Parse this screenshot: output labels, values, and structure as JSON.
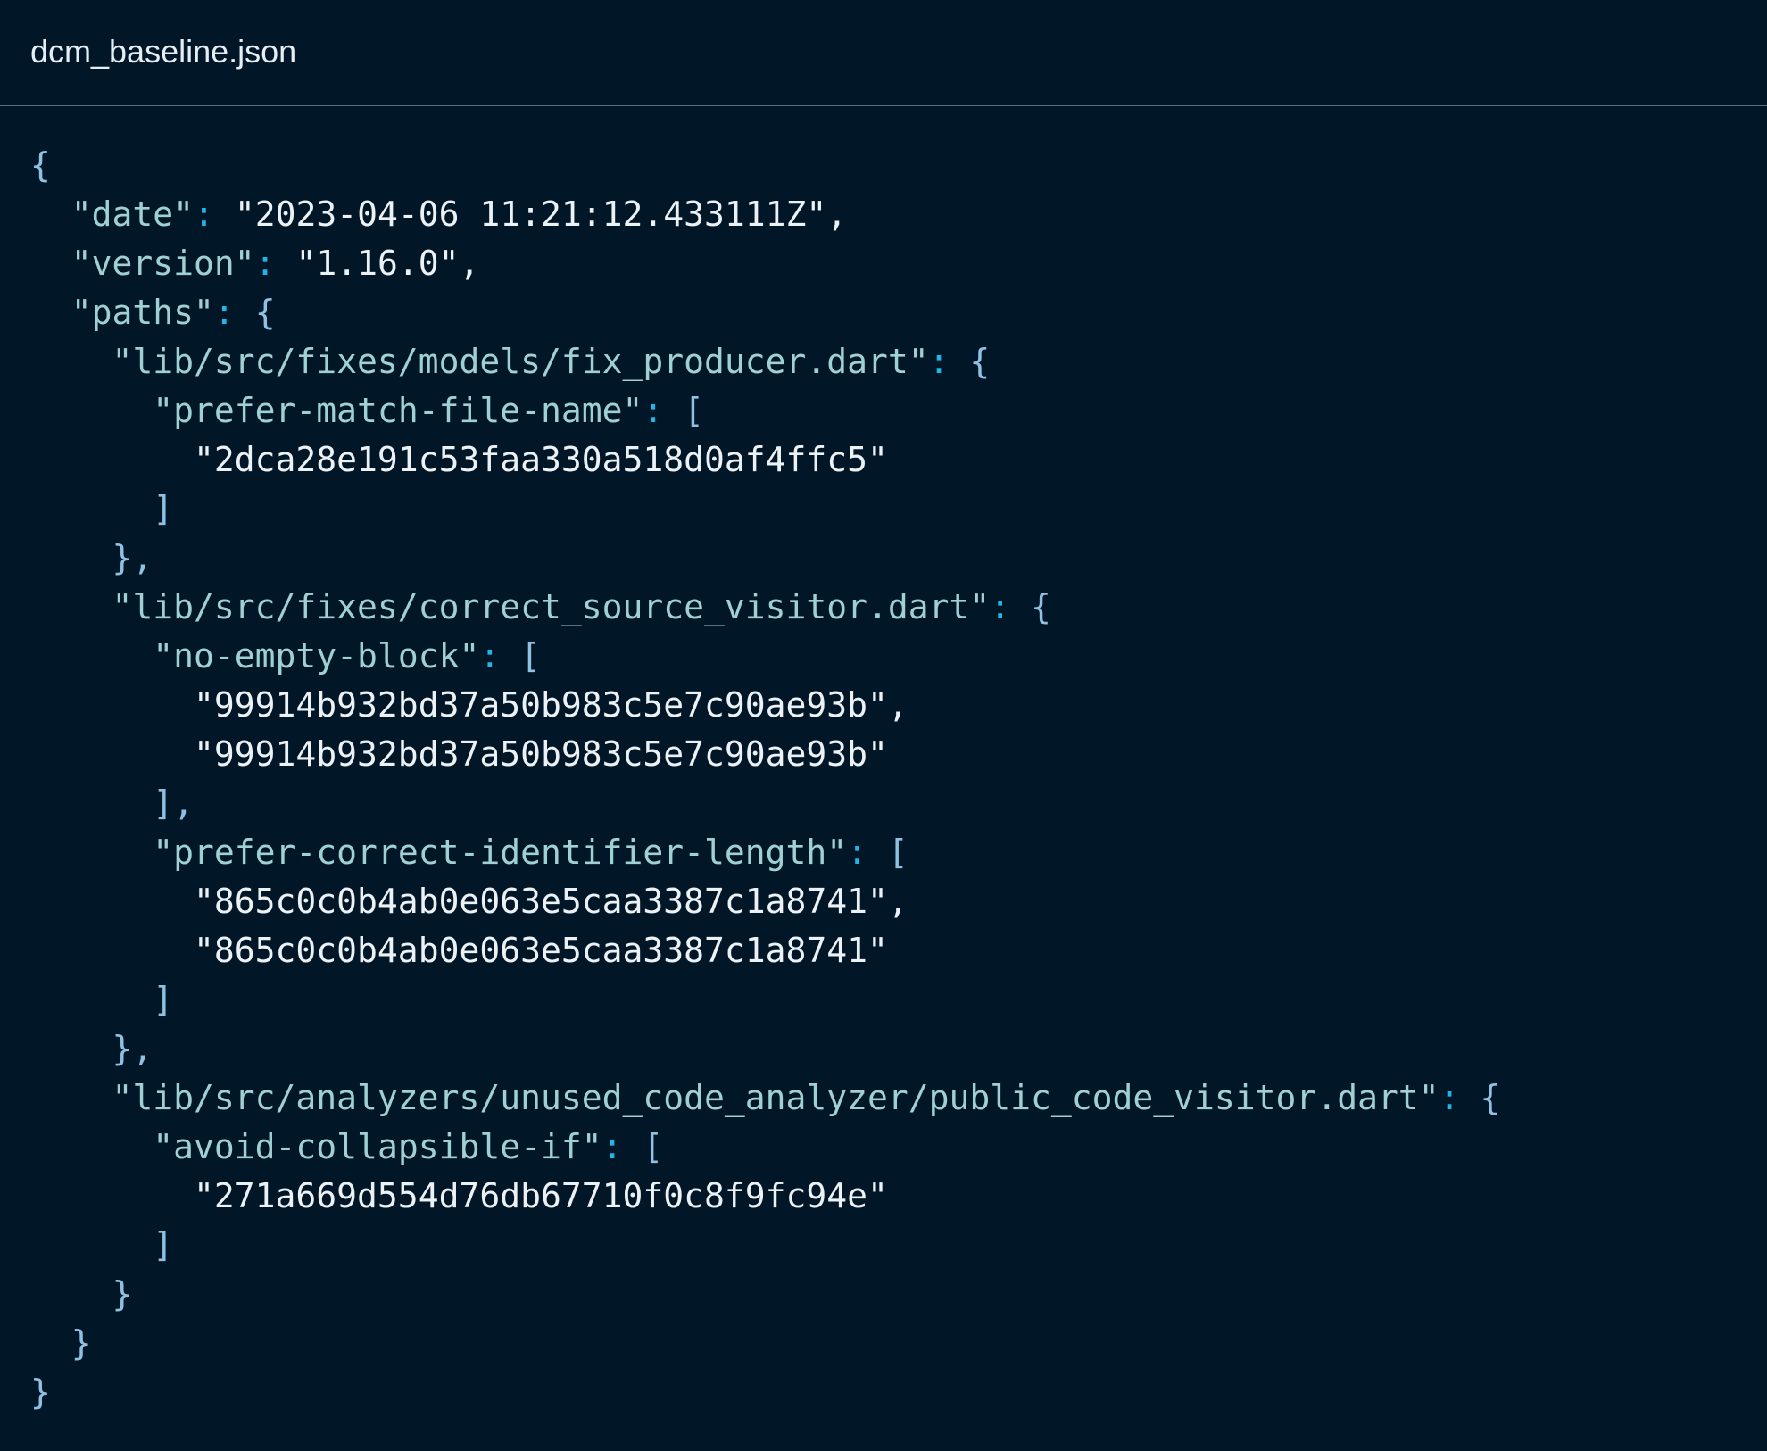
{
  "file": {
    "name": "dcm_baseline.json"
  },
  "colors": {
    "background": "#011627",
    "punctuation": "#8fc1e3",
    "colon": "#22b5e6",
    "key": "#9fd0d3",
    "string": "#ecf1f5",
    "divider": "#5f6f7d"
  },
  "code": {
    "lines": [
      [
        {
          "t": "p",
          "v": "{"
        }
      ],
      [
        {
          "t": "w",
          "v": "  "
        },
        {
          "t": "k",
          "v": "\"date\""
        },
        {
          "t": "c",
          "v": ": "
        },
        {
          "t": "s",
          "v": "\"2023-04-06 11:21:12.433111Z\""
        },
        {
          "t": "s",
          "v": ","
        }
      ],
      [
        {
          "t": "w",
          "v": "  "
        },
        {
          "t": "k",
          "v": "\"version\""
        },
        {
          "t": "c",
          "v": ": "
        },
        {
          "t": "s",
          "v": "\"1.16.0\""
        },
        {
          "t": "s",
          "v": ","
        }
      ],
      [
        {
          "t": "w",
          "v": "  "
        },
        {
          "t": "k",
          "v": "\"paths\""
        },
        {
          "t": "c",
          "v": ": "
        },
        {
          "t": "p",
          "v": "{"
        }
      ],
      [
        {
          "t": "w",
          "v": "    "
        },
        {
          "t": "k",
          "v": "\"lib/src/fixes/models/fix_producer.dart\""
        },
        {
          "t": "c",
          "v": ": "
        },
        {
          "t": "p",
          "v": "{"
        }
      ],
      [
        {
          "t": "w",
          "v": "      "
        },
        {
          "t": "k",
          "v": "\"prefer-match-file-name\""
        },
        {
          "t": "c",
          "v": ": "
        },
        {
          "t": "p",
          "v": "["
        }
      ],
      [
        {
          "t": "w",
          "v": "        "
        },
        {
          "t": "s",
          "v": "\"2dca28e191c53faa330a518d0af4ffc5\""
        }
      ],
      [
        {
          "t": "w",
          "v": "      "
        },
        {
          "t": "p",
          "v": "]"
        }
      ],
      [
        {
          "t": "w",
          "v": "    "
        },
        {
          "t": "p",
          "v": "},"
        }
      ],
      [
        {
          "t": "w",
          "v": "    "
        },
        {
          "t": "k",
          "v": "\"lib/src/fixes/correct_source_visitor.dart\""
        },
        {
          "t": "c",
          "v": ": "
        },
        {
          "t": "p",
          "v": "{"
        }
      ],
      [
        {
          "t": "w",
          "v": "      "
        },
        {
          "t": "k",
          "v": "\"no-empty-block\""
        },
        {
          "t": "c",
          "v": ": "
        },
        {
          "t": "p",
          "v": "["
        }
      ],
      [
        {
          "t": "w",
          "v": "        "
        },
        {
          "t": "s",
          "v": "\"99914b932bd37a50b983c5e7c90ae93b\""
        },
        {
          "t": "s",
          "v": ","
        }
      ],
      [
        {
          "t": "w",
          "v": "        "
        },
        {
          "t": "s",
          "v": "\"99914b932bd37a50b983c5e7c90ae93b\""
        }
      ],
      [
        {
          "t": "w",
          "v": "      "
        },
        {
          "t": "p",
          "v": "],"
        }
      ],
      [
        {
          "t": "w",
          "v": "      "
        },
        {
          "t": "k",
          "v": "\"prefer-correct-identifier-length\""
        },
        {
          "t": "c",
          "v": ": "
        },
        {
          "t": "p",
          "v": "["
        }
      ],
      [
        {
          "t": "w",
          "v": "        "
        },
        {
          "t": "s",
          "v": "\"865c0c0b4ab0e063e5caa3387c1a8741\""
        },
        {
          "t": "s",
          "v": ","
        }
      ],
      [
        {
          "t": "w",
          "v": "        "
        },
        {
          "t": "s",
          "v": "\"865c0c0b4ab0e063e5caa3387c1a8741\""
        }
      ],
      [
        {
          "t": "w",
          "v": "      "
        },
        {
          "t": "p",
          "v": "]"
        }
      ],
      [
        {
          "t": "w",
          "v": "    "
        },
        {
          "t": "p",
          "v": "},"
        }
      ],
      [
        {
          "t": "w",
          "v": "    "
        },
        {
          "t": "k",
          "v": "\"lib/src/analyzers/unused_code_analyzer/public_code_visitor.dart\""
        },
        {
          "t": "c",
          "v": ": "
        },
        {
          "t": "p",
          "v": "{"
        }
      ],
      [
        {
          "t": "w",
          "v": "      "
        },
        {
          "t": "k",
          "v": "\"avoid-collapsible-if\""
        },
        {
          "t": "c",
          "v": ": "
        },
        {
          "t": "p",
          "v": "["
        }
      ],
      [
        {
          "t": "w",
          "v": "        "
        },
        {
          "t": "s",
          "v": "\"271a669d554d76db67710f0c8f9fc94e\""
        }
      ],
      [
        {
          "t": "w",
          "v": "      "
        },
        {
          "t": "p",
          "v": "]"
        }
      ],
      [
        {
          "t": "w",
          "v": "    "
        },
        {
          "t": "p",
          "v": "}"
        }
      ],
      [
        {
          "t": "w",
          "v": "  "
        },
        {
          "t": "p",
          "v": "}"
        }
      ],
      [
        {
          "t": "p",
          "v": "}"
        }
      ]
    ]
  }
}
